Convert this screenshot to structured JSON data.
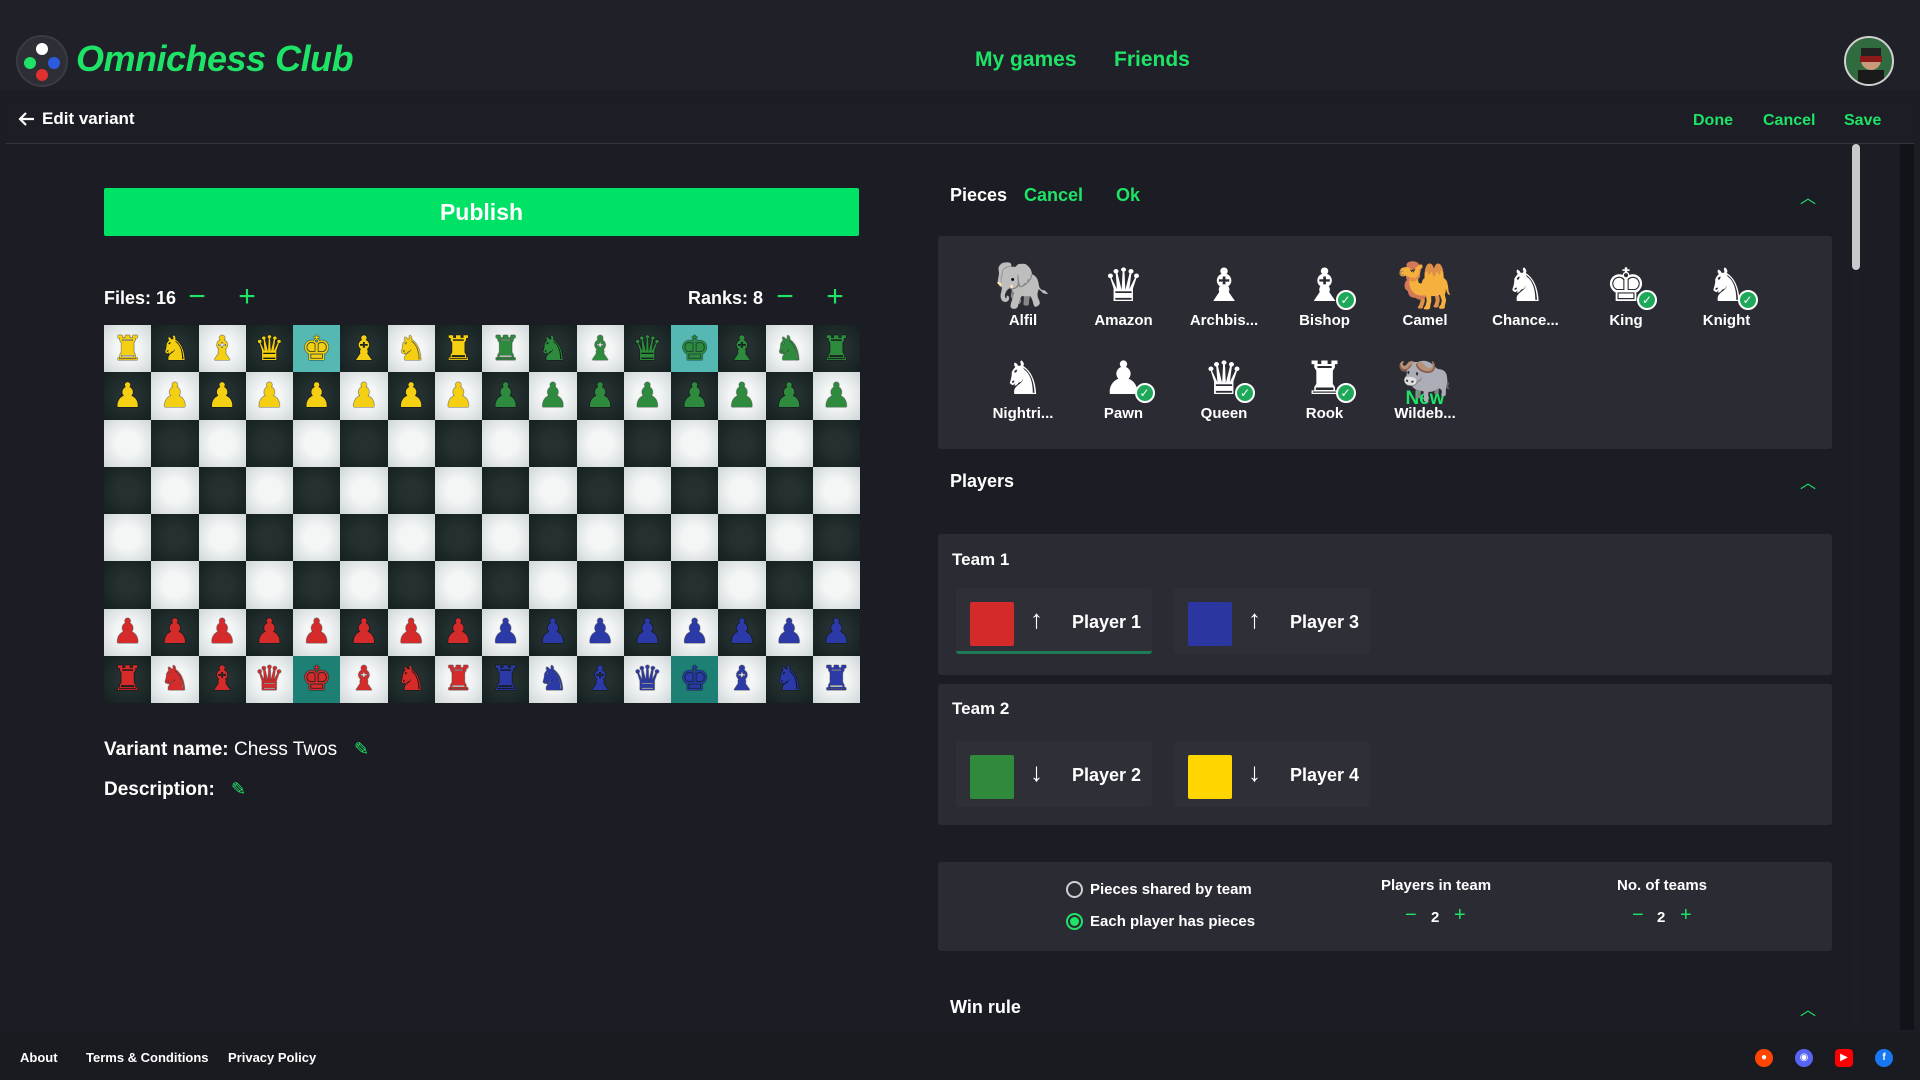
{
  "header": {
    "brand": "Omnichess Club",
    "nav": [
      "My games",
      "Friends"
    ]
  },
  "subbar": {
    "back_label": "Edit variant",
    "actions": [
      "Done",
      "Cancel",
      "Save"
    ]
  },
  "editor": {
    "publish_label": "Publish",
    "files_label": "Files: 16",
    "ranks_label": "Ranks: 8",
    "variant_name_label": "Variant name:",
    "variant_name_value": "Chess Twos",
    "description_label": "Description:"
  },
  "board": {
    "files": 16,
    "ranks": 8,
    "rows": [
      [
        "y:♜",
        "y:♞",
        "y:♝",
        "y:♛",
        "y:♚",
        "y:♝",
        "y:♞",
        "y:♜",
        "g:♜",
        "g:♞",
        "g:♝",
        "g:♛",
        "g:♚",
        "g:♝",
        "g:♞",
        "g:♜"
      ],
      [
        "y:♟",
        "y:♟",
        "y:♟",
        "y:♟",
        "y:♟",
        "y:♟",
        "y:♟",
        "y:♟",
        "g:♟",
        "g:♟",
        "g:♟",
        "g:♟",
        "g:♟",
        "g:♟",
        "g:♟",
        "g:♟"
      ],
      [],
      [],
      [],
      [],
      [
        "r:♟",
        "r:♟",
        "r:♟",
        "r:♟",
        "r:♟",
        "r:♟",
        "r:♟",
        "r:♟",
        "b:♟",
        "b:♟",
        "b:♟",
        "b:♟",
        "b:♟",
        "b:♟",
        "b:♟",
        "b:♟"
      ],
      [
        "r:♜",
        "r:♞",
        "r:♝",
        "r:♛",
        "r:♚",
        "r:♝",
        "r:♞",
        "r:♜",
        "b:♜",
        "b:♞",
        "b:♝",
        "b:♛",
        "b:♚",
        "b:♝",
        "b:♞",
        "b:♜"
      ]
    ],
    "piece_colors": {
      "y": "#f5cf12",
      "g": "#2e8b3e",
      "r": "#d62b2b",
      "b": "#2c3aa8"
    },
    "highlighted_squares": [
      "0-4",
      "0-12",
      "7-4",
      "7-12"
    ]
  },
  "pieces": {
    "title": "Pieces",
    "cancel_label": "Cancel",
    "ok_label": "Ok",
    "items": [
      {
        "name": "Alfil",
        "glyph": "🐘",
        "checked": false
      },
      {
        "name": "Amazon",
        "glyph": "♛",
        "checked": false
      },
      {
        "name": "Archbis...",
        "glyph": "♝",
        "checked": false
      },
      {
        "name": "Bishop",
        "glyph": "♝",
        "checked": true
      },
      {
        "name": "Camel",
        "glyph": "🐫",
        "checked": false
      },
      {
        "name": "Chance...",
        "glyph": "♞",
        "checked": false
      },
      {
        "name": "King",
        "glyph": "♚",
        "checked": true
      },
      {
        "name": "Knight",
        "glyph": "♞",
        "checked": true
      },
      {
        "name": "Nightri...",
        "glyph": "♞",
        "checked": false
      },
      {
        "name": "Pawn",
        "glyph": "♟",
        "checked": true
      },
      {
        "name": "Queen",
        "glyph": "♛",
        "checked": true
      },
      {
        "name": "Rook",
        "glyph": "♜",
        "checked": true
      },
      {
        "name": "Wildeb...",
        "glyph": "🐃",
        "checked": false
      }
    ],
    "new_plus": "+",
    "new_label": "New"
  },
  "players": {
    "title": "Players",
    "teams": [
      {
        "name": "Team 1",
        "players": [
          {
            "name": "Player 1",
            "color": "#d42a2a",
            "arrow": "↑"
          },
          {
            "name": "Player 3",
            "color": "#2c36a0",
            "arrow": "↑"
          }
        ]
      },
      {
        "name": "Team 2",
        "players": [
          {
            "name": "Player 2",
            "color": "#2f8a3b",
            "arrow": "↓"
          },
          {
            "name": "Player 4",
            "color": "#ffd600",
            "arrow": "↓"
          }
        ]
      }
    ],
    "option_shared": "Pieces shared by team",
    "option_each": "Each player has pieces",
    "selected_option": "each",
    "players_in_team_label": "Players in team",
    "players_in_team_value": "2",
    "teams_label": "No. of teams",
    "teams_value": "2",
    "minus": "−",
    "plus": "+"
  },
  "win_rule": {
    "title": "Win rule"
  },
  "footer": {
    "links": [
      "About",
      "Terms & Conditions",
      "Privacy Policy"
    ],
    "social": [
      "reddit-icon",
      "discord-icon",
      "youtube-icon",
      "facebook-icon"
    ]
  }
}
